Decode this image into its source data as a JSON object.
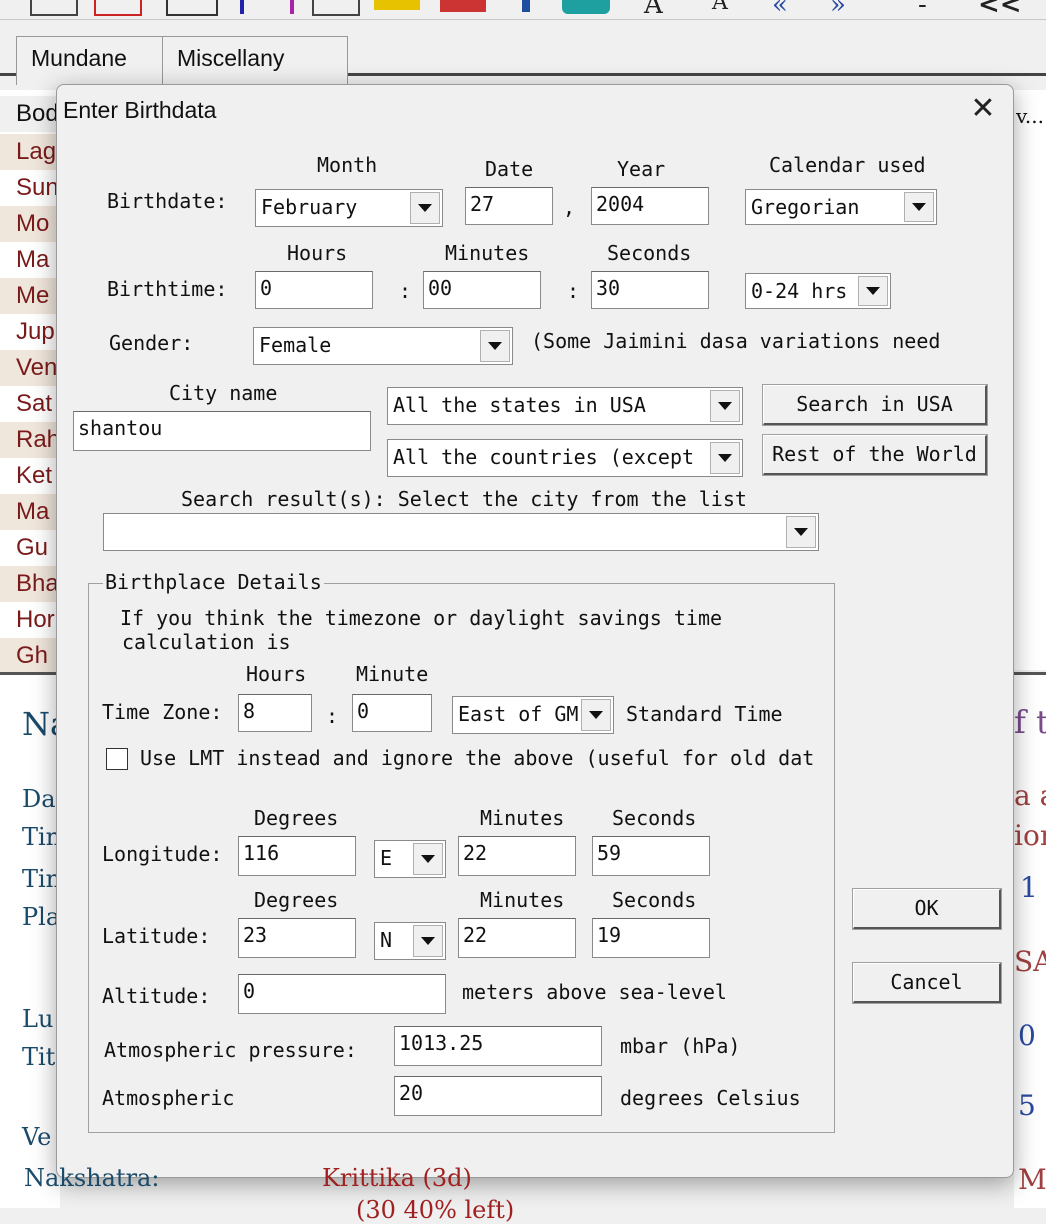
{
  "background": {
    "toolbar_glyphs": [
      "A",
      "A",
      "«",
      "»",
      "-",
      "<<"
    ],
    "tabs": [
      "Mundane",
      "Miscellany"
    ],
    "planet_list": [
      "Lag",
      "Sun",
      "Mo",
      "Ma",
      "Me",
      "Jup",
      "Ven",
      "Sat",
      "Rah",
      "Ket",
      "Ma",
      "Gu",
      "Bha",
      "Hor",
      "Gh"
    ],
    "planet_header": "Bod",
    "lower_labels": [
      "Na",
      "Dat",
      "Tin",
      "Tin",
      "Pla",
      "Lu",
      "Tit",
      "Ve",
      "Nakshatra:"
    ],
    "lower_extra": [
      "Krittika (3d)",
      "(30 40% left)"
    ],
    "right_fragments": [
      "v...",
      "f t",
      "a a",
      "ion",
      "1",
      "SAV",
      "0",
      "5",
      "Mo"
    ]
  },
  "dialog": {
    "title": "Enter Birthdata",
    "close_glyph": "✕",
    "birthdate": {
      "label": "Birthdate:",
      "month_header": "Month",
      "date_header": "Date",
      "year_header": "Year",
      "calendar_header": "Calendar used",
      "month_value": "February",
      "date_value": "27",
      "separator": ",",
      "year_value": "2004",
      "calendar_value": "Gregorian"
    },
    "birthtime": {
      "label": "Birthtime:",
      "hours_header": "Hours",
      "minutes_header": "Minutes",
      "seconds_header": "Seconds",
      "hours_value": "0",
      "minutes_value": "00",
      "seconds_value": "30",
      "colon": ":",
      "format_value": "0-24 hrs"
    },
    "gender": {
      "label": "Gender:",
      "value": "Female",
      "note": "(Some Jaimini dasa variations need"
    },
    "city": {
      "header": "City name",
      "value": "shantou",
      "states_value": "All the states in USA",
      "countries_value": "All the countries (except",
      "search_usa_button": "Search in USA",
      "rest_world_button": "Rest of the World"
    },
    "search_results": {
      "label": "Search result(s): Select the city from the list",
      "value": ""
    },
    "birthplace": {
      "legend": "Birthplace Details",
      "note_line1": "If you think the timezone or daylight savings time",
      "note_line2": "calculation is",
      "tz_label": "Time Zone:",
      "tz_hours_header": "Hours",
      "tz_minute_header": "Minute",
      "tz_hours_value": "8",
      "tz_colon": ":",
      "tz_minute_value": "0",
      "tz_direction_value": "East of GM",
      "tz_standard": "Standard Time",
      "lmt_label": "Use LMT instead and ignore the above (useful for old dat",
      "lmt_checked": false,
      "longitude": {
        "label": "Longitude:",
        "deg_header": "Degrees",
        "min_header": "Minutes",
        "sec_header": "Seconds",
        "deg": "116",
        "dir": "E",
        "min": "22",
        "sec": "59"
      },
      "latitude": {
        "label": "Latitude:",
        "deg_header": "Degrees",
        "min_header": "Minutes",
        "sec_header": "Seconds",
        "deg": "23",
        "dir": "N",
        "min": "22",
        "sec": "19"
      },
      "altitude": {
        "label": "Altitude:",
        "value": "0",
        "unit": "meters above sea-level"
      },
      "pressure": {
        "label": "Atmospheric pressure:",
        "value": "1013.25",
        "unit": "mbar (hPa)"
      },
      "temperature": {
        "label": "Atmospheric",
        "value": "20",
        "unit": "degrees Celsius"
      }
    },
    "ok_button": "OK",
    "cancel_button": "Cancel"
  }
}
